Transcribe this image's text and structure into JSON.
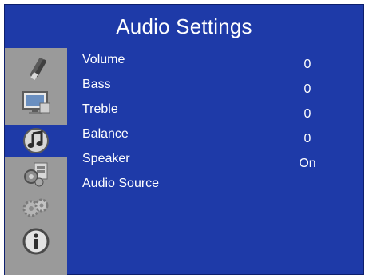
{
  "window": {
    "title": "Audio Settings",
    "background_color": "#1e3aa8",
    "sidebar_color": "#9a9a9a"
  },
  "sidebar": {
    "tabs": [
      {
        "id": "picture",
        "icon": "brush-icon",
        "active": false
      },
      {
        "id": "display",
        "icon": "monitor-icon",
        "active": false
      },
      {
        "id": "audio",
        "icon": "music-note-icon",
        "active": true
      },
      {
        "id": "setup",
        "icon": "tools-icon",
        "active": false
      },
      {
        "id": "advanced",
        "icon": "gears-icon",
        "active": false
      },
      {
        "id": "info",
        "icon": "info-icon",
        "active": false
      }
    ]
  },
  "menu": {
    "items": [
      {
        "label": "Volume",
        "value": "0"
      },
      {
        "label": "Bass",
        "value": "0"
      },
      {
        "label": "Treble",
        "value": "0"
      },
      {
        "label": "Balance",
        "value": "0"
      },
      {
        "label": "Speaker",
        "value": "On"
      },
      {
        "label": "Audio Source",
        "value": ""
      }
    ]
  }
}
